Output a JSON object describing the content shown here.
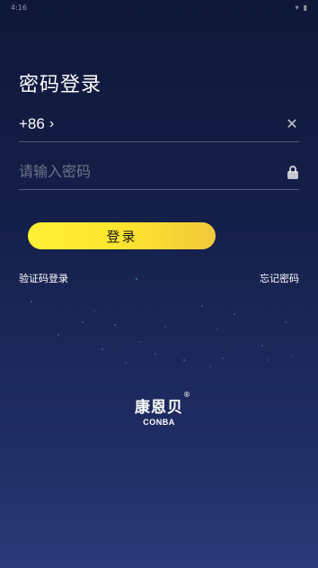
{
  "status_bar": {
    "time": "4:16",
    "wifi_icon": "wifi-icon",
    "battery_icon": "battery-icon"
  },
  "page": {
    "title": "密码登录"
  },
  "phone_row": {
    "country_code": "+86",
    "chevron_icon": "chevron-right-icon",
    "clear_icon": "close-icon"
  },
  "password_row": {
    "placeholder": "请输入密码",
    "value": "",
    "lock_icon": "lock-icon"
  },
  "login_button": {
    "label": "登录",
    "gradient": [
      "#fff136",
      "#f1c83a"
    ]
  },
  "links": {
    "sms_login": "验证码登录",
    "forgot_password": "忘记密码"
  },
  "brand": {
    "name_cn": "康恩贝",
    "name_en": "CONBA",
    "registered": "®"
  },
  "colors": {
    "background_top": "#0f1738",
    "background_bottom": "#2a3a77",
    "accent": "#ffe52e"
  }
}
